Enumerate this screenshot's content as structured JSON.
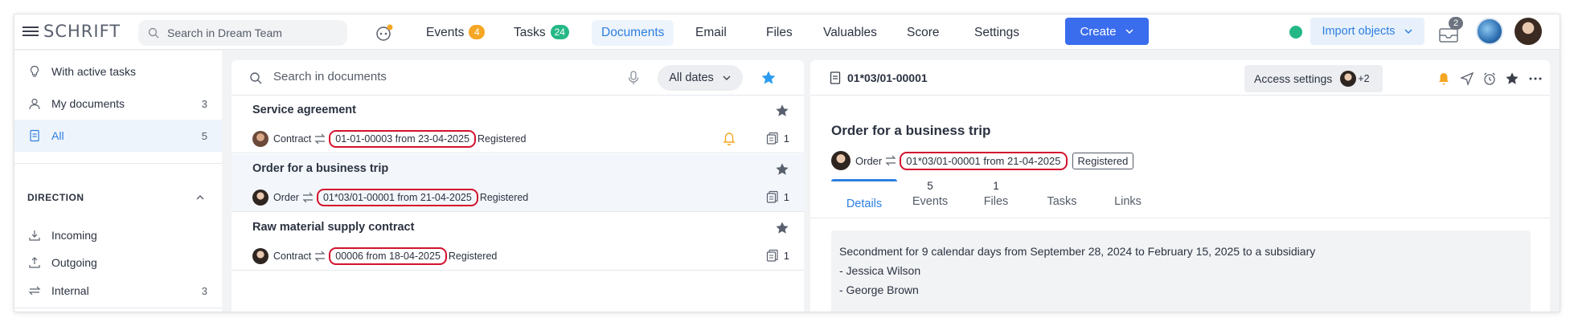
{
  "app": {
    "logo": "SCHRIFT"
  },
  "topbar": {
    "search_placeholder": "Search in Dream Team",
    "nav": [
      {
        "label": "Events",
        "badge": "4",
        "badge_color": "#f5a623"
      },
      {
        "label": "Tasks",
        "badge": "24",
        "badge_color": "#25b887"
      },
      {
        "label": "Documents",
        "active": true
      },
      {
        "label": "Email"
      },
      {
        "label": "Files"
      },
      {
        "label": "Valuables"
      },
      {
        "label": "Score"
      },
      {
        "label": "Settings"
      }
    ],
    "create_label": "Create",
    "import_label": "Import objects",
    "inbox_badge": "2"
  },
  "sidebar": {
    "items": [
      {
        "label": "With active tasks",
        "icon": "lightbulb-icon",
        "count": ""
      },
      {
        "label": "My documents",
        "icon": "user-icon",
        "count": "3"
      },
      {
        "label": "All",
        "icon": "document-icon",
        "count": "5"
      }
    ],
    "direction_heading": "DIRECTION",
    "direction_items": [
      {
        "label": "Incoming",
        "icon": "download-icon",
        "count": ""
      },
      {
        "label": "Outgoing",
        "icon": "upload-icon",
        "count": ""
      },
      {
        "label": "Internal",
        "icon": "exchange-icon",
        "count": "3"
      }
    ]
  },
  "list": {
    "search_placeholder": "Search in documents",
    "dates_filter": "All dates",
    "rows": [
      {
        "title": "Service agreement",
        "type": "Contract",
        "number": "01-01-00003  from 23-04-2025",
        "status": "Registered",
        "files": "1",
        "has_bell": true
      },
      {
        "title": "Order for a business trip",
        "type": "Order",
        "number": "01*03/01-00001  from 21-04-2025",
        "status": "Registered",
        "files": "1",
        "has_bell": false
      },
      {
        "title": "Raw material supply contract",
        "type": "Contract",
        "number": "00006  from 18-04-2025",
        "status": "Registered",
        "files": "1",
        "has_bell": false
      }
    ]
  },
  "detail": {
    "doc_id": "01*03/01-00001",
    "access_label": "Access settings",
    "access_extra": "+2",
    "title": "Order for a business trip",
    "type": "Order",
    "number": "01*03/01-00001  from 21-04-2025",
    "status": "Registered",
    "tabs": [
      {
        "label": "Details",
        "count": "",
        "active": true
      },
      {
        "label": "Events",
        "count": "5"
      },
      {
        "label": "Files",
        "count": "1"
      },
      {
        "label": "Tasks",
        "count": ""
      },
      {
        "label": "Links",
        "count": ""
      }
    ],
    "description": "Secondment for 9 calendar days from September 28, 2024 to February 15, 2025 to a subsidiary",
    "people": [
      "- Jessica Wilson",
      "- George Brown"
    ]
  },
  "colors": {
    "accent": "#2d7fe0",
    "primary_button": "#3a6ded",
    "highlight": "#d3122d",
    "bell": "#f5a623",
    "online": "#25b887"
  }
}
